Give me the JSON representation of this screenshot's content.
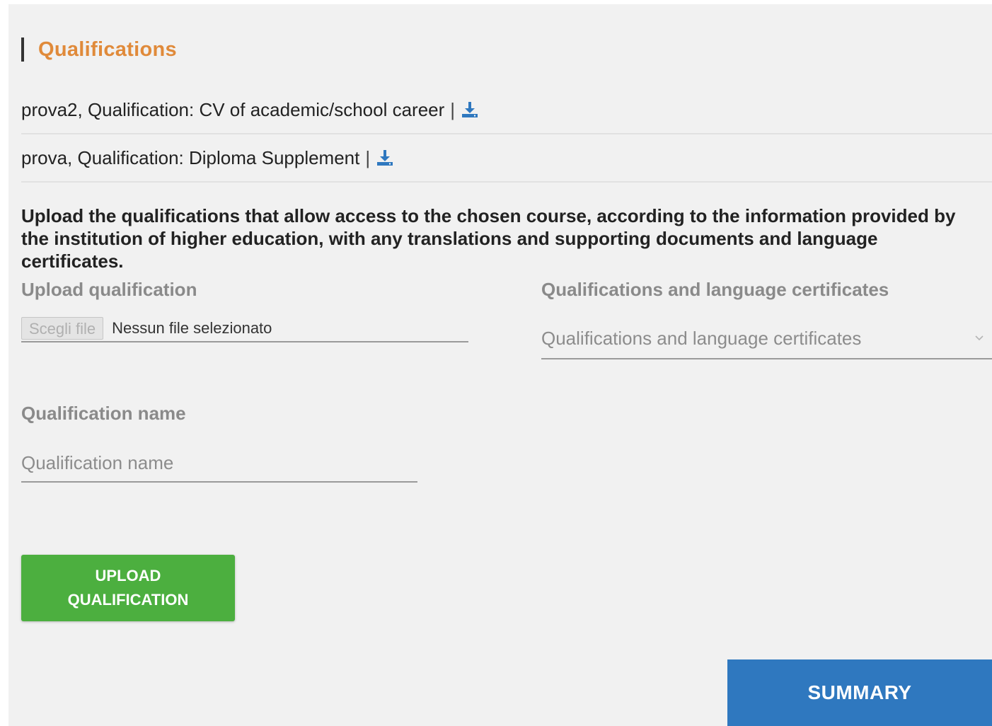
{
  "section": {
    "title": "Qualifications"
  },
  "uploaded_qualifications": [
    {
      "text": "prova2, Qualification: CV of academic/school career",
      "separator": "|",
      "icon": "download-icon"
    },
    {
      "text": "prova, Qualification: Diploma Supplement",
      "separator": "|",
      "icon": "download-icon"
    }
  ],
  "instructions": "Upload the qualifications that allow access to the chosen course, according to the information provided by the institution of higher education, with any translations and supporting documents and language certificates.",
  "upload_field": {
    "label": "Upload qualification",
    "button_label": "Scegli file",
    "status": "Nessun file selezionato"
  },
  "type_select": {
    "label": "Qualifications and language certificates",
    "value": "Qualifications and language certificates",
    "icon": "chevron-down-icon"
  },
  "name_field": {
    "label": "Qualification name",
    "placeholder": "Qualification name",
    "value": ""
  },
  "actions": {
    "upload_label": "UPLOAD QUALIFICATION",
    "summary_label": "SUMMARY"
  },
  "colors": {
    "heading": "#e08a3a",
    "upload_button": "#4caf3f",
    "summary_button": "#2f78bf",
    "download_icon": "#2f78bf"
  }
}
